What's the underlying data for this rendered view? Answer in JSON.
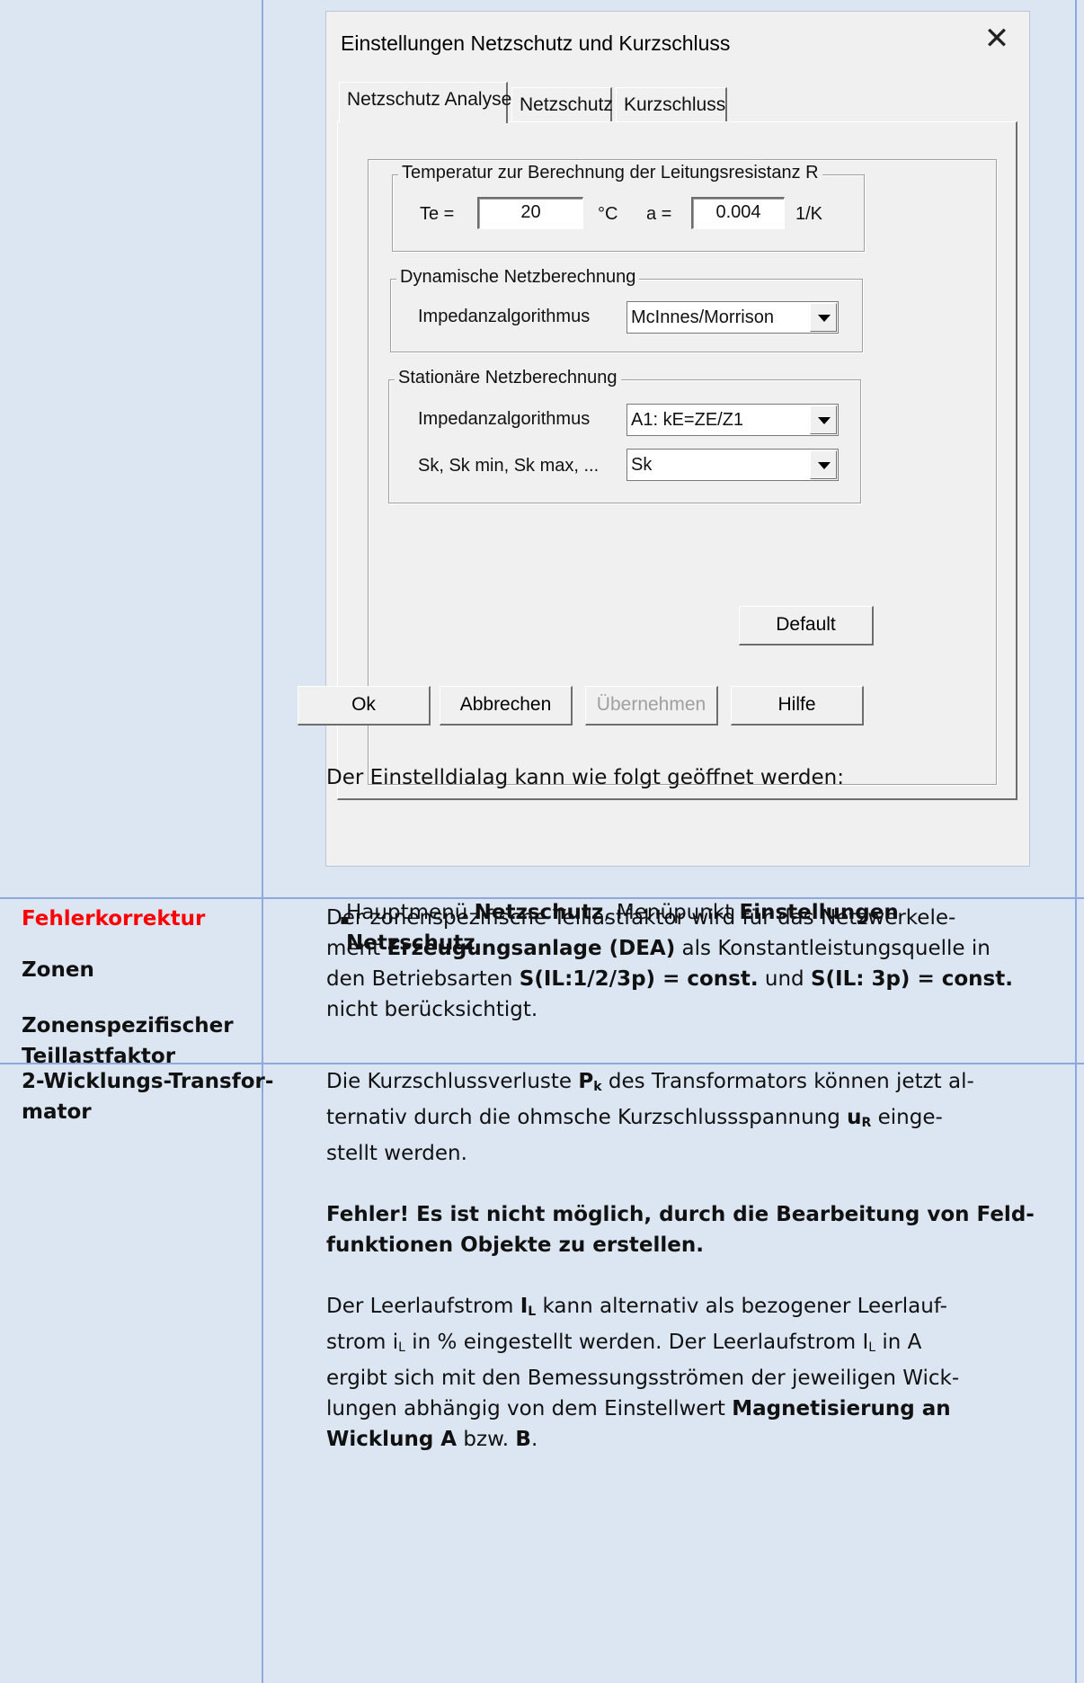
{
  "dialog": {
    "title": "Einstellungen Netzschutz und Kurzschluss",
    "tabs": [
      "Netzschutz Analyse",
      "Netzschutz",
      "Kurzschluss"
    ],
    "temp_group": {
      "label": "Temperatur zur Berechnung der Leitungsresistanz R",
      "te_label": "Te =",
      "te_value": "20",
      "te_unit": "°C",
      "a_label": "a =",
      "a_value": "0.004",
      "a_unit": "1/K"
    },
    "dyn_group": {
      "label": "Dynamische Netzberechnung",
      "impedanz_label": "Impedanzalgorithmus",
      "impedanz_value": "McInnes/Morrison"
    },
    "stat_group": {
      "label": "Stationäre Netzberechnung",
      "impedanz_label": "Impedanzalgorithmus",
      "impedanz_value": "A1: kE=ZE/Z1",
      "sk_label": "Sk, Sk min, Sk max, ...",
      "sk_value": "Sk"
    },
    "default_button": "Default",
    "buttons": {
      "ok": "Ok",
      "cancel": "Abbrechen",
      "apply": "Übernehmen",
      "help": "Hilfe"
    }
  },
  "row1": {
    "intro": "Der Einstelldialag kann wie folgt geöffnet werden:",
    "bullet_pre": "Hauptmenü ",
    "bullet_b1": "Netzschutz",
    "bullet_mid": ", Menüpunkt ",
    "bullet_b2": "Einstellungen",
    "bullet_b3": "Netzschutz"
  },
  "row2": {
    "left_1": "Fehlerkorrektur",
    "left_2": "Zonen",
    "left_3a": "Zonenspezifischer",
    "left_3b": "Teillastfaktor",
    "t1": "Der zonenspezifische Teillastfaktor wird für das Netzwerkele-",
    "t2a": "ment ",
    "t2b": "Erzeugungsanlage (DEA)",
    "t2c": " als Konstantleistungsquelle in",
    "t3a": "den Betriebsarten ",
    "t3b": "S(IL:1/2/3p) = const.",
    "t3c": " und ",
    "t3d": "S(IL: 3p) = const.",
    "t4": "nicht berücksichtigt."
  },
  "row3": {
    "left_1": "2-Wicklungs-Transfor-",
    "left_2": "mator",
    "p1_1a": "Die Kurzschlussverluste ",
    "p1_1b": "P",
    "p1_1sub": "k",
    "p1_1c": " des Transformators können jetzt al-",
    "p1_2a": "ternativ durch die ohmsche Kurzschlussspannung ",
    "p1_2b": "u",
    "p1_2sub": "R",
    "p1_2c": " einge-",
    "p1_3": "stellt werden.",
    "err_1": "Fehler! Es ist nicht möglich, durch die Bearbeitung von Feld-",
    "err_2": "funktionen Objekte zu erstellen.",
    "p2_1a": "Der Leerlaufstrom ",
    "p2_1b": "I",
    "p2_1sub": "L",
    "p2_1c": " kann alternativ als bezogener Leerlauf-",
    "p2_2a": "strom i",
    "p2_2sub": "L",
    "p2_2b": " in % eingestellt werden. Der Leerlaufstrom I",
    "p2_2sub2": "L",
    "p2_2c": " in A",
    "p2_3": "ergibt sich mit den Bemessungsströmen der jeweiligen Wick-",
    "p2_4a": "lungen abhängig von dem Einstellwert ",
    "p2_4b": "Magnetisierung an",
    "p2_5a": "Wicklung A",
    "p2_5b": " bzw. ",
    "p2_5c": "B",
    "p2_5d": "."
  }
}
